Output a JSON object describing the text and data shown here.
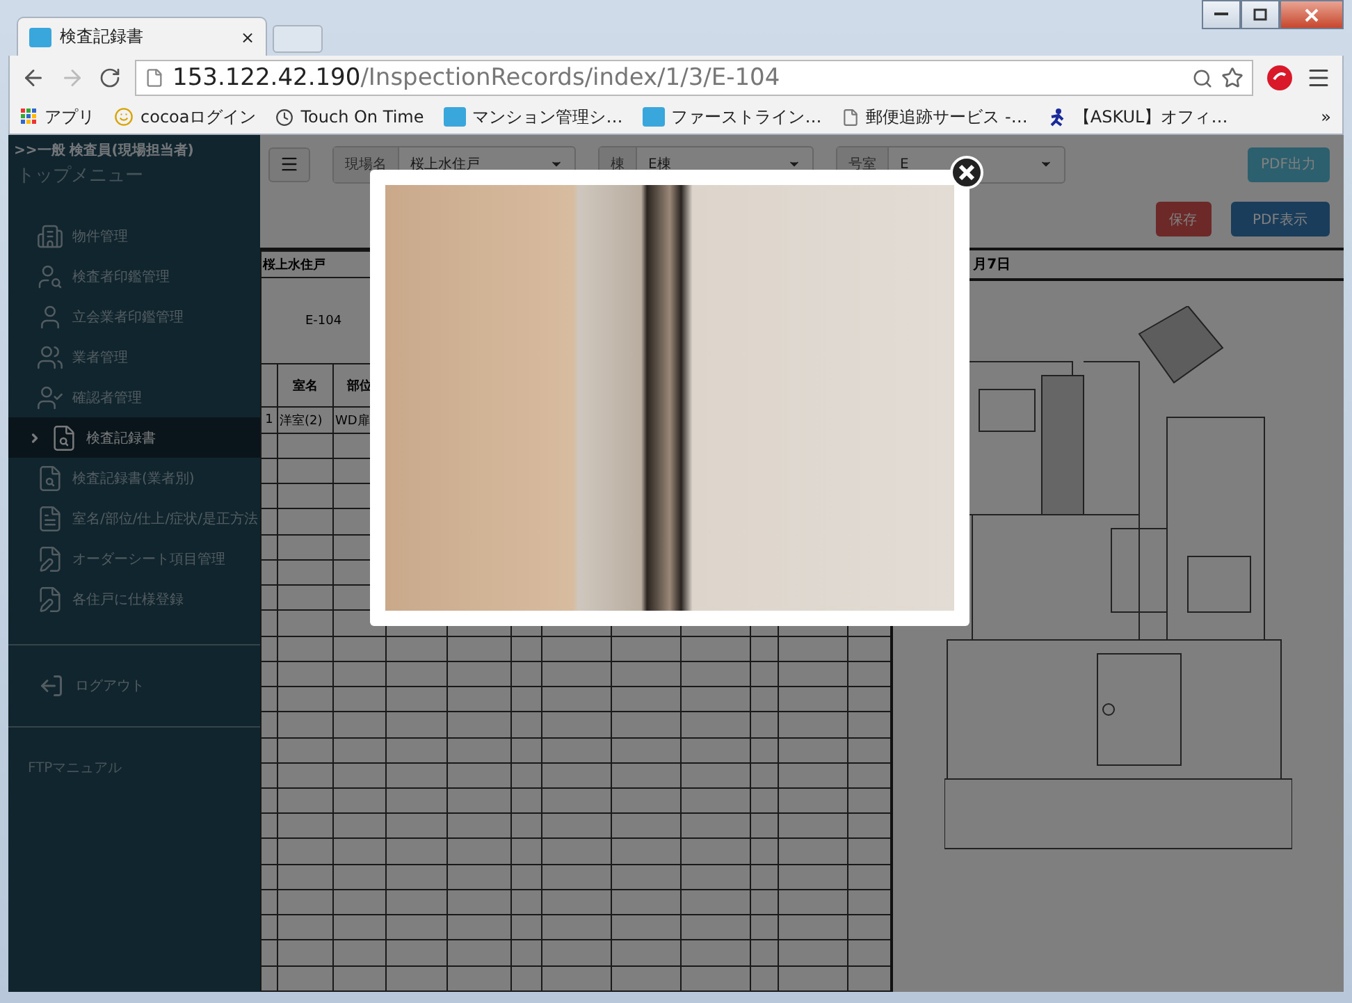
{
  "browser": {
    "tab_title": "検査記録書",
    "tab_close": "×",
    "url_host": "153.122.42.190",
    "url_path": "/InspectionRecords/index/1/3/E-104",
    "overflow": "»",
    "bookmarks": [
      {
        "label": "アプリ",
        "kind": "apps"
      },
      {
        "label": "cocoaログイン",
        "kind": "smiley"
      },
      {
        "label": "Touch On Time",
        "kind": "clock"
      },
      {
        "label": "マンション管理シ…",
        "kind": "badge"
      },
      {
        "label": "ファーストライン…",
        "kind": "badge"
      },
      {
        "label": "郵便追跡サービス -…",
        "kind": "page"
      },
      {
        "label": "【ASKUL】オフィ…",
        "kind": "runner"
      }
    ]
  },
  "sidebar": {
    "user": ">>一般 検査員(現場担当者)",
    "heading": "トップメニュー",
    "items": [
      {
        "label": "物件管理",
        "selected": false
      },
      {
        "label": "検査者印鑑管理",
        "selected": false
      },
      {
        "label": "立会業者印鑑管理",
        "selected": false
      },
      {
        "label": "業者管理",
        "selected": false
      },
      {
        "label": "確認者管理",
        "selected": false
      },
      {
        "label": "検査記録書",
        "selected": true
      },
      {
        "label": "検査記録書(業者別)",
        "selected": false
      },
      {
        "label": "室名/部位/仕上/症状/是正方法",
        "selected": false
      },
      {
        "label": "オーダーシート項目管理",
        "selected": false
      },
      {
        "label": "各住戸に仕様登録",
        "selected": false
      }
    ],
    "logout": "ログアウト",
    "manual": "FTPマニュアル"
  },
  "toolbar": {
    "filters": [
      {
        "label": "現場名",
        "value": "桜上水住戸"
      },
      {
        "label": "棟",
        "value": "E棟"
      },
      {
        "label": "号室",
        "value": "E"
      }
    ],
    "pdf_output": "PDF出力",
    "save": "保存",
    "pdf_view": "PDF表示"
  },
  "record": {
    "site": "桜上水住戸",
    "date": "月7日",
    "unit": "E-104",
    "columns": [
      "室名",
      "部位"
    ],
    "rows": [
      {
        "no": "1",
        "cells": [
          "洋室(2)",
          "WD扉"
        ]
      }
    ]
  }
}
